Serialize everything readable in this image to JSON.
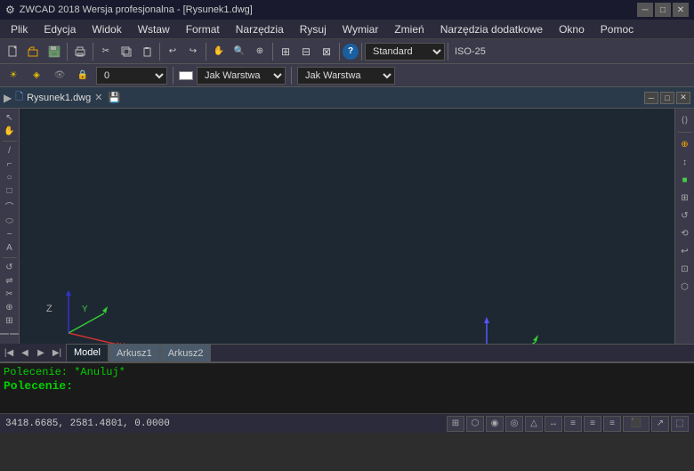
{
  "titleBar": {
    "appIcon": "⚙",
    "title": "ZWCAD 2018 Wersja profesjonalna - [Rysunek1.dwg]",
    "controls": {
      "minimize": "─",
      "maximize": "□",
      "close": "✕"
    }
  },
  "menuBar": {
    "items": [
      {
        "label": "Plik",
        "id": "menu-plik"
      },
      {
        "label": "Edycja",
        "id": "menu-edycja"
      },
      {
        "label": "Widok",
        "id": "menu-widok"
      },
      {
        "label": "Wstaw",
        "id": "menu-wstaw"
      },
      {
        "label": "Format",
        "id": "menu-format"
      },
      {
        "label": "Narzędzia",
        "id": "menu-narzedzia"
      },
      {
        "label": "Rysuj",
        "id": "menu-rysuj"
      },
      {
        "label": "Wymiar",
        "id": "menu-wymiar"
      },
      {
        "label": "Zmień",
        "id": "menu-zmien"
      },
      {
        "label": "Narzędzia dodatkowe",
        "id": "menu-narzedziaDodatkowe"
      },
      {
        "label": "Okno",
        "id": "menu-okno"
      },
      {
        "label": "Pomoc",
        "id": "menu-pomoc"
      }
    ]
  },
  "toolbar1": {
    "buttons": [
      "📄",
      "📂",
      "💾",
      "🖨",
      "✂",
      "📋",
      "📑",
      "↩",
      "↪",
      "⬚",
      "⬚",
      "⬚",
      "⬚",
      "⬚",
      "⬚",
      "⬚",
      "⬚",
      "⬚",
      "⬚",
      "⬚",
      "⬚",
      "⬚",
      "⬚"
    ],
    "comboLabel": "Standard",
    "comboValue": "Standard",
    "textRight": "ISO-25"
  },
  "layerBar": {
    "icons": [
      "🔆",
      "⬡",
      "👁",
      "🔒"
    ],
    "layerName": "0",
    "layerComboPlaceholder": "0",
    "colorLabel": "Jak Warstwa",
    "colorCombo": "Jak Warstwa",
    "lineLabel": "Jak Warstwa",
    "lineCombo": "Jak Warstwa"
  },
  "drawingTab": {
    "icon": "📐",
    "name": "Rysunek1.dwg",
    "hasClose": true,
    "hasSave": true
  },
  "drawingWindow": {
    "minBtn": "─",
    "maxBtn": "□",
    "closeBtn": "✕"
  },
  "modelTabs": [
    {
      "label": "Model",
      "active": true
    },
    {
      "label": "Arkusz1",
      "active": false
    },
    {
      "label": "Arkusz2",
      "active": false
    }
  ],
  "commandArea": {
    "line1": "Polecenie: *Anuluj*",
    "line2": "Polecenie:"
  },
  "statusBar": {
    "coords": "3418.6685, 2581.4801, 0.0000",
    "buttons": [
      "⊞",
      "⬡",
      "⊙",
      "◎",
      "△",
      "↔",
      "≡",
      "≡",
      "≡",
      "⬛",
      "↗",
      "⬚"
    ]
  },
  "leftTools": [
    "↖",
    "↔",
    "⬜",
    "⬡",
    "⊙",
    "⬜",
    "⌒",
    "△",
    "⊂",
    "✏",
    "S",
    "↺",
    "↪",
    "⬡",
    "✂",
    "⊕",
    "⊞",
    "⬡"
  ],
  "rightTools": [
    "⊞",
    "↕",
    "🎨",
    "⊕",
    "◎",
    "↺",
    "↩",
    "⬡",
    "⬡"
  ],
  "canvas": {
    "bgColor": "#1e2832",
    "axisOriginX": 550,
    "axisOriginY": 310,
    "labels": {
      "Z": "Z",
      "Y": "Y",
      "X": "X"
    }
  }
}
